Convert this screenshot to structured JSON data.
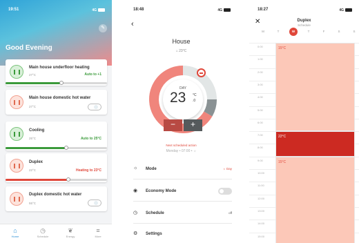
{
  "home": {
    "status": {
      "time": "19:51",
      "network": "4G"
    },
    "greeting": "Good Evening",
    "cards": [
      {
        "name": "Main house underfloor heating",
        "temp": "27°C",
        "status": "Auto to +1",
        "accent": "#3a9a3a",
        "level": 0.55
      },
      {
        "name": "Main house domestic hot water",
        "temp": "27°C"
      },
      {
        "name": "Cooling",
        "temp": "25°C",
        "status": "Auto to 25°C",
        "accent": "#3a9a3a",
        "level": 0.6
      },
      {
        "name": "Duplex",
        "temp": "22°C",
        "status": "Heating to 23°C",
        "accent": "#e0473a",
        "level": 0.62
      },
      {
        "name": "Duplex domestic hot water",
        "temp": "55°C"
      }
    ],
    "nav": [
      {
        "label": "Home",
        "icon": "home-icon",
        "glyph": "⌂",
        "active": true
      },
      {
        "label": "Schedule",
        "icon": "clock-icon",
        "glyph": "◷"
      },
      {
        "label": "Energy",
        "icon": "leaf-icon",
        "glyph": "❦"
      },
      {
        "label": "More",
        "icon": "menu-icon",
        "glyph": "≡"
      }
    ]
  },
  "detail": {
    "status": {
      "time": "18:48",
      "network": "4G"
    },
    "title": "House",
    "current_temp": "23°C",
    "dial": {
      "mode_label": "DAY",
      "setpoint": "23",
      "unit": "°C",
      "decimal": ".0",
      "minus": "−",
      "plus": "+"
    },
    "next_action_label": "Next scheduled action",
    "next_action_value": "Monday • 07:00 •",
    "next_action_icon": "☼",
    "rows": [
      {
        "label": "Mode",
        "value": "Day",
        "icon": "☼"
      },
      {
        "label": "Economy Mode"
      },
      {
        "label": "Schedule",
        "value": "off"
      },
      {
        "label": "Settings"
      }
    ]
  },
  "schedule": {
    "status": {
      "time": "18:27",
      "network": "4G"
    },
    "title": "Duplex",
    "subtitle": "Schedule",
    "days": [
      "M",
      "T",
      "W",
      "T",
      "F",
      "S",
      "S"
    ],
    "active_day": 2,
    "hours": [
      "0:00",
      "1:00",
      "2:00",
      "3:00",
      "4:00",
      "5:00",
      "6:00",
      "7:00",
      "8:00",
      "9:00",
      "10:00",
      "11:00",
      "12:00",
      "13:00",
      "14:00",
      "15:00"
    ],
    "blocks": [
      {
        "label": "15°C",
        "start": 0,
        "end": 7,
        "color": "#fcc8b8",
        "text": "#e0473a"
      },
      {
        "label": "22°C",
        "start": 7,
        "end": 9,
        "color": "#cc2a22",
        "text": "#ffffff"
      },
      {
        "label": "15°C",
        "start": 9,
        "end": 16,
        "color": "#fcc8b8",
        "text": "#e0473a"
      }
    ]
  }
}
